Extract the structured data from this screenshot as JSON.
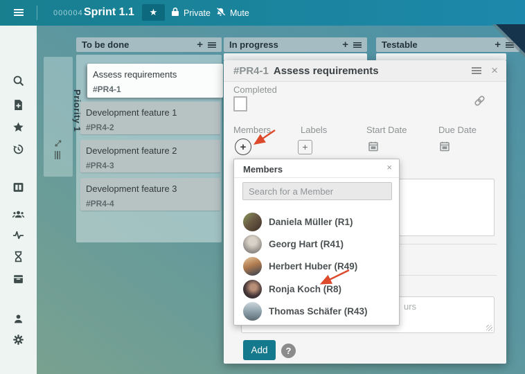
{
  "topbar": {
    "board_number": "000004",
    "board_title": "Sprint 1.1",
    "private_label": "Private",
    "mute_label": "Mute"
  },
  "icons": {
    "plus": "+",
    "close": "×",
    "star": "★",
    "question": "?"
  },
  "sidebar": {
    "items": [
      {
        "icon": "search-icon"
      },
      {
        "icon": "add-document-icon"
      },
      {
        "icon": "star-icon"
      },
      {
        "icon": "history-icon"
      },
      {
        "icon": "board-columns-icon"
      },
      {
        "icon": "users-icon"
      },
      {
        "icon": "activity-icon"
      },
      {
        "icon": "hourglass-icon"
      },
      {
        "icon": "archive-icon"
      },
      {
        "icon": "user-icon"
      },
      {
        "icon": "settings-icon"
      }
    ]
  },
  "board": {
    "columns": [
      {
        "label": "To be done"
      },
      {
        "label": "In progress"
      },
      {
        "label": "Testable"
      }
    ],
    "swimlane": {
      "label": "Priority 1"
    },
    "cards": [
      {
        "title": "Assess requirements",
        "ref": "#PR4-1",
        "state": "active"
      },
      {
        "title": "Development feature 1",
        "ref": "#PR4-2",
        "state": "default"
      },
      {
        "title": "Development feature 2",
        "ref": "#PR4-3",
        "state": "default"
      },
      {
        "title": "Development feature 3",
        "ref": "#PR4-4",
        "state": "default"
      }
    ]
  },
  "task_modal": {
    "ref": "#PR4-1",
    "title": "Assess requirements",
    "completed_label": "Completed",
    "fields": [
      {
        "label": "Members"
      },
      {
        "label": "Labels"
      },
      {
        "label": "Start Date"
      },
      {
        "label": "Due Date"
      }
    ],
    "comment_placeholder_visible": "urs",
    "add_button": "Add"
  },
  "members_popover": {
    "title": "Members",
    "search_placeholder": "Search for a Member",
    "members": [
      {
        "name": "Daniela Müller (R1)"
      },
      {
        "name": "Georg Hart (R41)"
      },
      {
        "name": "Herbert Huber (R49)"
      },
      {
        "name": "Ronja Koch (R8)"
      },
      {
        "name": "Thomas Schäfer (R43)"
      }
    ]
  },
  "colors": {
    "topbar_left": "#187f8f",
    "topbar_right": "#1d88ab",
    "accent_teal": "#15798d",
    "column_header_bg": "#a6bcc3",
    "card_bg": "#b7c2c3",
    "active_card_bg": "#fbfcfc",
    "annotation_arrow_red": "#dc4a2b",
    "corner_fold": "#17344d"
  }
}
